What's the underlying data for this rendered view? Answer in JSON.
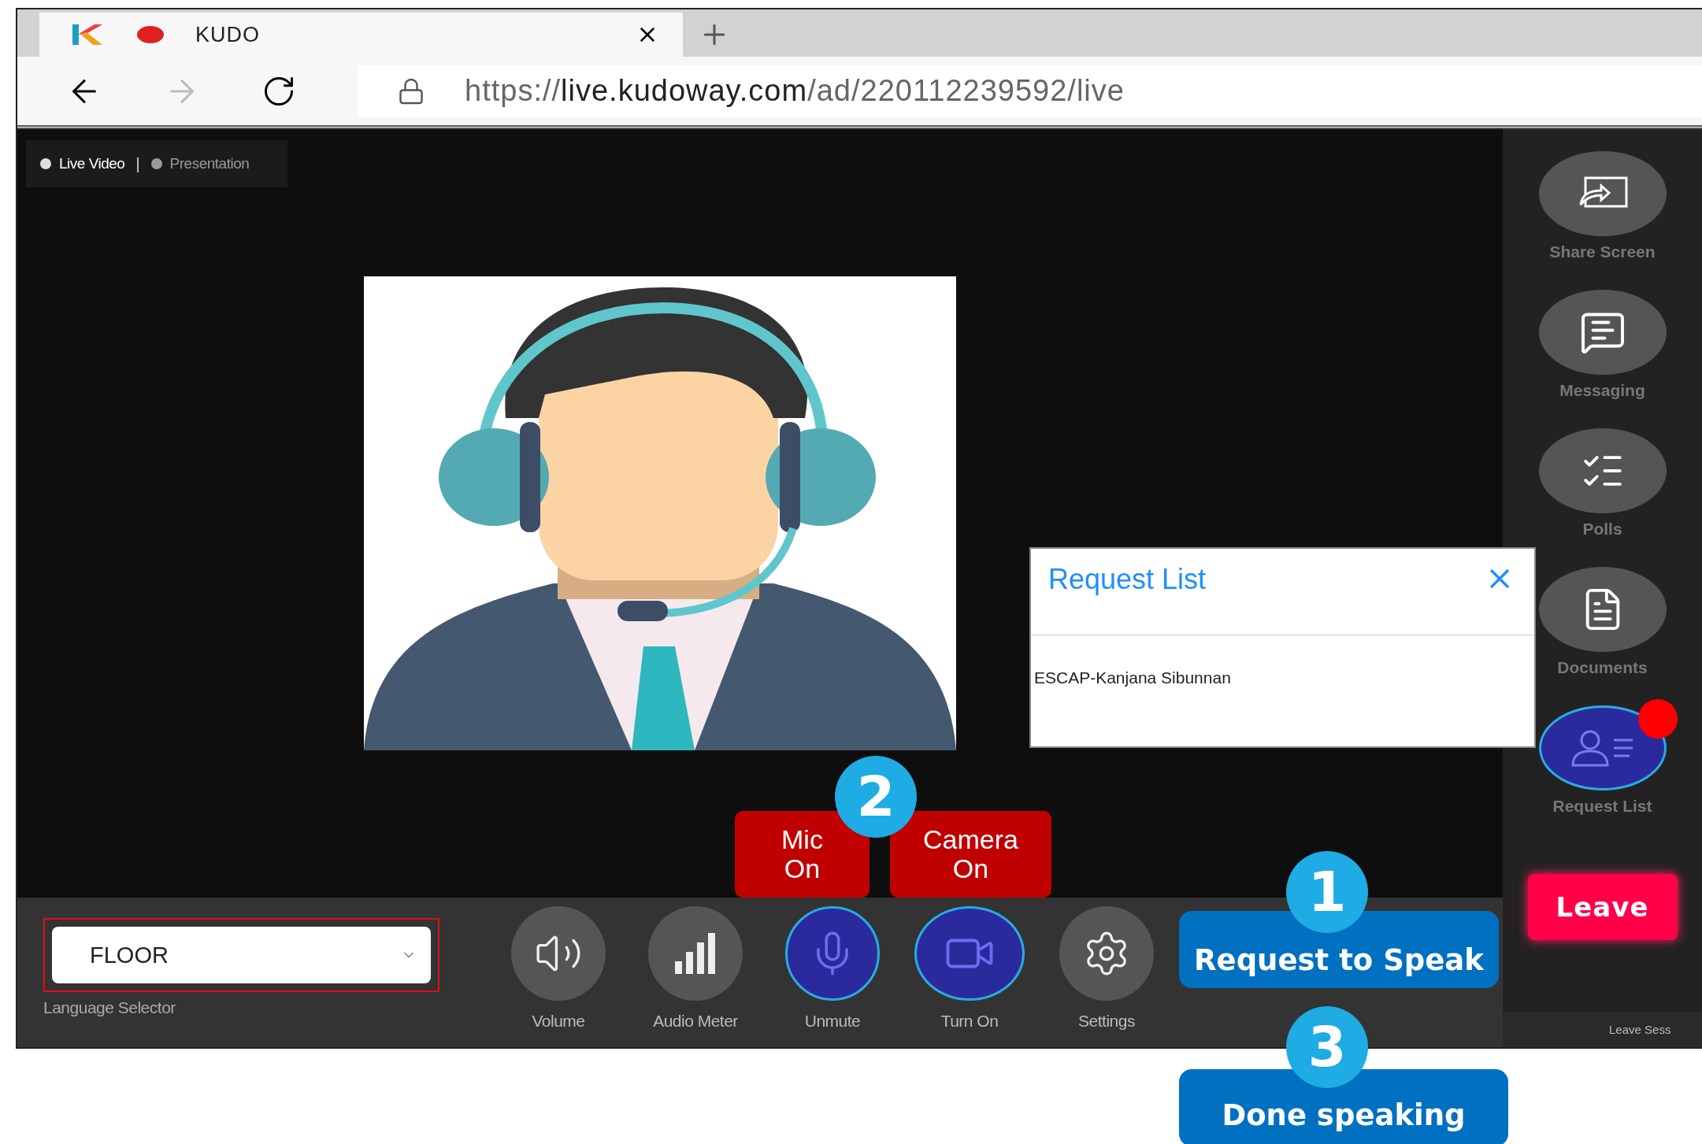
{
  "browser": {
    "tab": {
      "title": "KUDO",
      "recording": true
    },
    "url": {
      "scheme": "https://",
      "host": "live.kudoway.com",
      "path": "/ad/220112239592/live"
    }
  },
  "view_tabs": [
    {
      "label": "Live Video",
      "selected": true
    },
    {
      "label": "Presentation",
      "selected": false
    }
  ],
  "view_separator": "|",
  "sidebar": {
    "items": [
      {
        "kind": "share",
        "label": "Share Screen",
        "active": false,
        "notification": false
      },
      {
        "kind": "messaging",
        "label": "Messaging",
        "active": false,
        "notification": false
      },
      {
        "kind": "polls",
        "label": "Polls",
        "active": false,
        "notification": false
      },
      {
        "kind": "documents",
        "label": "Documents",
        "active": false,
        "notification": false
      },
      {
        "kind": "requests",
        "label": "Request List",
        "active": true,
        "notification": true
      }
    ],
    "leave": "Leave",
    "leave_session": "Leave Sess"
  },
  "toolbar": {
    "language": {
      "value": "FLOOR",
      "label": "Language Selector",
      "highlighted": true
    },
    "controls": [
      {
        "kind": "volume",
        "label": "Volume",
        "active": false
      },
      {
        "kind": "meter",
        "label": "Audio Meter",
        "active": false
      },
      {
        "kind": "mic",
        "label": "Unmute",
        "active": true
      },
      {
        "kind": "camera",
        "label": "Turn On",
        "active": true
      },
      {
        "kind": "settings",
        "label": "Settings",
        "active": false
      }
    ]
  },
  "request_list": {
    "title": "Request List",
    "entries": [
      "ESCAP-Kanjana Sibunnan"
    ]
  },
  "annotations": {
    "steps": [
      {
        "number": "1",
        "label": "Request to Speak"
      },
      {
        "number": "3",
        "label": "Done speaking"
      }
    ],
    "callout_number": "2",
    "callouts": [
      "Mic On",
      "Camera On"
    ]
  }
}
